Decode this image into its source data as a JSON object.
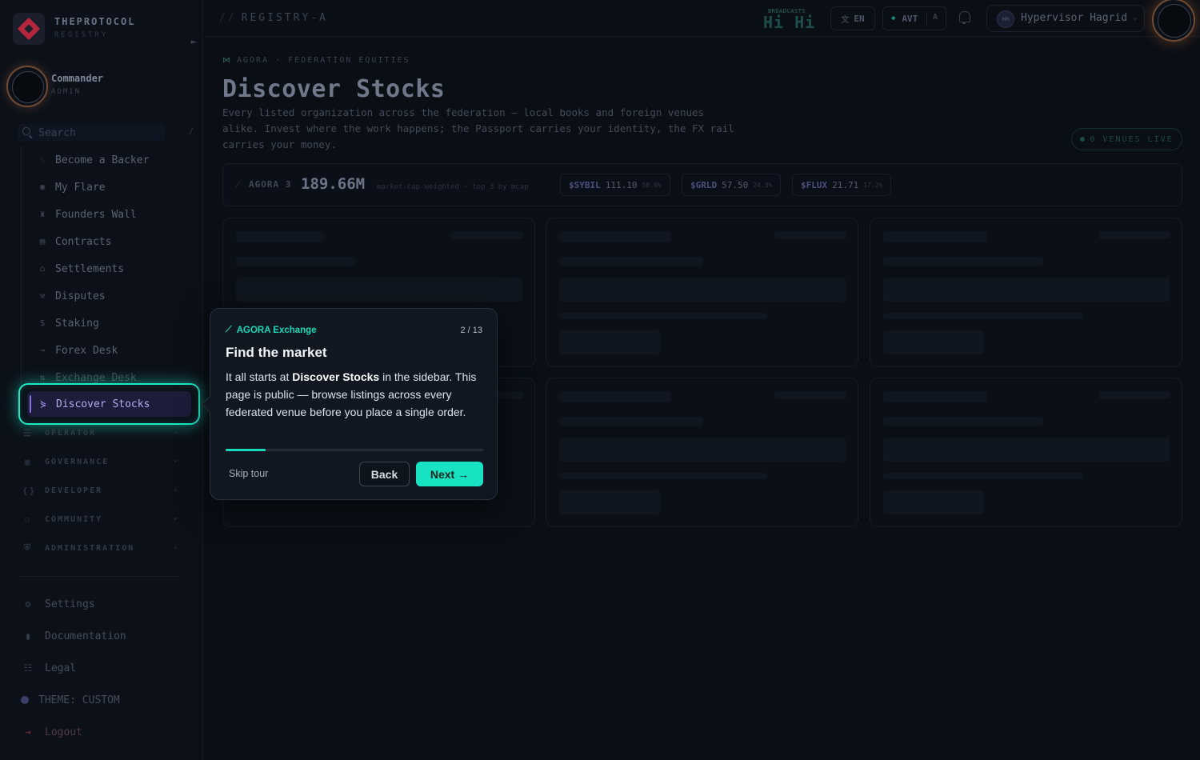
{
  "brand": {
    "name": "THEPROTOCOL",
    "sub": "REGISTRY"
  },
  "user": {
    "name": "Commander",
    "role": "ADMIN"
  },
  "search": {
    "placeholder": "Search",
    "shortcut": "/"
  },
  "sidebar": {
    "items": [
      {
        "label": "Become a Backer",
        "icon": "backer-icon"
      },
      {
        "label": "My Flare",
        "icon": "shield-icon"
      },
      {
        "label": "Founders Wall",
        "icon": "trophy-icon"
      },
      {
        "label": "Contracts",
        "icon": "document-icon"
      },
      {
        "label": "Settlements",
        "icon": "bank-icon"
      },
      {
        "label": "Disputes",
        "icon": "gavel-icon"
      },
      {
        "label": "Staking",
        "icon": "dollar-icon"
      },
      {
        "label": "Forex Desk",
        "icon": "trend-icon"
      },
      {
        "label": "Exchange Desk",
        "icon": "exchange-icon"
      }
    ],
    "active": {
      "label": "Discover Stocks",
      "icon": "discover-icon"
    },
    "sections": [
      "OPERATOR",
      "GOVERNANCE",
      "DEVELOPER",
      "COMMUNITY",
      "ADMINISTRATION"
    ],
    "footer": {
      "settings": "Settings",
      "documentation": "Documentation",
      "legal": "Legal",
      "theme": "THEME: CUSTOM",
      "logout": "Logout"
    }
  },
  "topbar": {
    "registry": "REGISTRY-A",
    "broadcast_label": "BROADCASTS",
    "broadcast_text": "Hi  Hi",
    "lang": "EN",
    "currency": "AVT",
    "currency_mode": "A",
    "profile_initials": "HH",
    "profile_name": "Hypervisor Hagrid"
  },
  "main": {
    "breadcrumb": "AGORA · FEDERATION EQUITIES",
    "title": "Discover Stocks",
    "description": "Every listed organization across the federation — local books and foreign venues alike. Invest where the work happens; the Passport carries your identity, the FX rail carries your money.",
    "venues_live": "0 VENUES LIVE",
    "ticker": {
      "label": "AGORA 3",
      "value": "189.66M",
      "note": "market-cap-weighted · top 3 by mcap",
      "chips": [
        {
          "symbol": "$SYBIL",
          "price": "111.10",
          "pct": "58.6%"
        },
        {
          "symbol": "$GRLD",
          "price": "57.50",
          "pct": "24.3%"
        },
        {
          "symbol": "$FLUX",
          "price": "21.71",
          "pct": "17.2%"
        }
      ]
    }
  },
  "tour": {
    "tag": "AGORA Exchange",
    "step": "2 / 13",
    "progress": 0.154,
    "title": "Find the market",
    "body_prefix": "It all starts at ",
    "body_bold": "Discover Stocks",
    "body_suffix": " in the sidebar. This page is public — browse listings across every federated venue before you place a single order.",
    "skip": "Skip tour",
    "back": "Back",
    "next": "Next →"
  },
  "colors": {
    "accent": "#17e3c2",
    "active_nav": "#b9a8ee",
    "danger": "#b4263c"
  }
}
